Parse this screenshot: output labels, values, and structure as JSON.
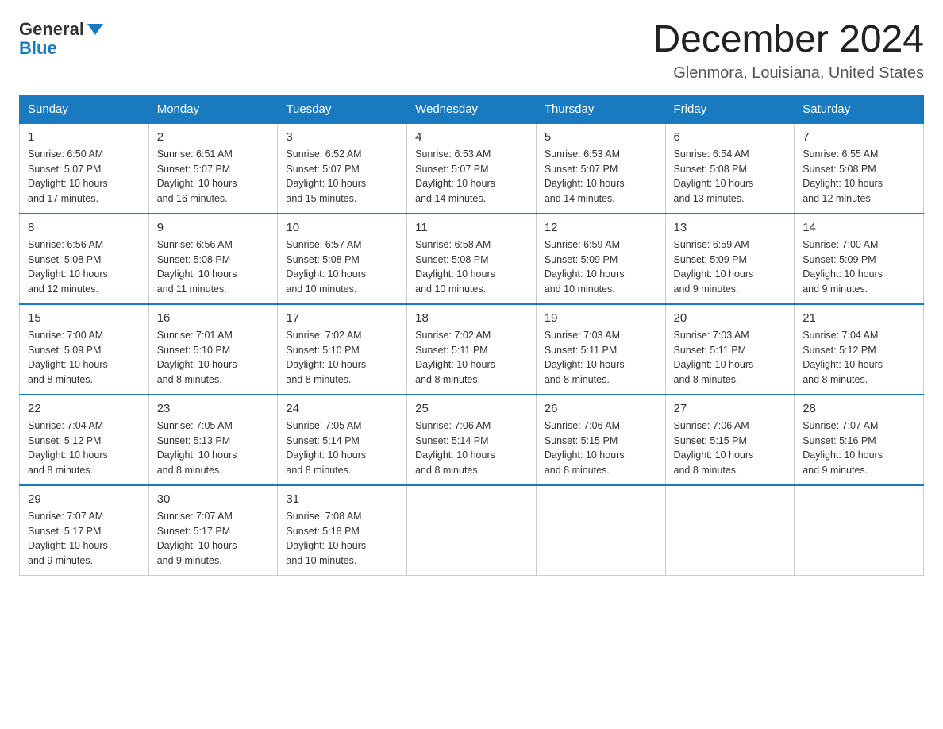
{
  "logo": {
    "general": "General",
    "blue": "Blue"
  },
  "title": "December 2024",
  "location": "Glenmora, Louisiana, United States",
  "weekdays": [
    "Sunday",
    "Monday",
    "Tuesday",
    "Wednesday",
    "Thursday",
    "Friday",
    "Saturday"
  ],
  "weeks": [
    [
      {
        "day": "1",
        "sunrise": "6:50 AM",
        "sunset": "5:07 PM",
        "daylight": "10 hours and 17 minutes."
      },
      {
        "day": "2",
        "sunrise": "6:51 AM",
        "sunset": "5:07 PM",
        "daylight": "10 hours and 16 minutes."
      },
      {
        "day": "3",
        "sunrise": "6:52 AM",
        "sunset": "5:07 PM",
        "daylight": "10 hours and 15 minutes."
      },
      {
        "day": "4",
        "sunrise": "6:53 AM",
        "sunset": "5:07 PM",
        "daylight": "10 hours and 14 minutes."
      },
      {
        "day": "5",
        "sunrise": "6:53 AM",
        "sunset": "5:07 PM",
        "daylight": "10 hours and 14 minutes."
      },
      {
        "day": "6",
        "sunrise": "6:54 AM",
        "sunset": "5:08 PM",
        "daylight": "10 hours and 13 minutes."
      },
      {
        "day": "7",
        "sunrise": "6:55 AM",
        "sunset": "5:08 PM",
        "daylight": "10 hours and 12 minutes."
      }
    ],
    [
      {
        "day": "8",
        "sunrise": "6:56 AM",
        "sunset": "5:08 PM",
        "daylight": "10 hours and 12 minutes."
      },
      {
        "day": "9",
        "sunrise": "6:56 AM",
        "sunset": "5:08 PM",
        "daylight": "10 hours and 11 minutes."
      },
      {
        "day": "10",
        "sunrise": "6:57 AM",
        "sunset": "5:08 PM",
        "daylight": "10 hours and 10 minutes."
      },
      {
        "day": "11",
        "sunrise": "6:58 AM",
        "sunset": "5:08 PM",
        "daylight": "10 hours and 10 minutes."
      },
      {
        "day": "12",
        "sunrise": "6:59 AM",
        "sunset": "5:09 PM",
        "daylight": "10 hours and 10 minutes."
      },
      {
        "day": "13",
        "sunrise": "6:59 AM",
        "sunset": "5:09 PM",
        "daylight": "10 hours and 9 minutes."
      },
      {
        "day": "14",
        "sunrise": "7:00 AM",
        "sunset": "5:09 PM",
        "daylight": "10 hours and 9 minutes."
      }
    ],
    [
      {
        "day": "15",
        "sunrise": "7:00 AM",
        "sunset": "5:09 PM",
        "daylight": "10 hours and 8 minutes."
      },
      {
        "day": "16",
        "sunrise": "7:01 AM",
        "sunset": "5:10 PM",
        "daylight": "10 hours and 8 minutes."
      },
      {
        "day": "17",
        "sunrise": "7:02 AM",
        "sunset": "5:10 PM",
        "daylight": "10 hours and 8 minutes."
      },
      {
        "day": "18",
        "sunrise": "7:02 AM",
        "sunset": "5:11 PM",
        "daylight": "10 hours and 8 minutes."
      },
      {
        "day": "19",
        "sunrise": "7:03 AM",
        "sunset": "5:11 PM",
        "daylight": "10 hours and 8 minutes."
      },
      {
        "day": "20",
        "sunrise": "7:03 AM",
        "sunset": "5:11 PM",
        "daylight": "10 hours and 8 minutes."
      },
      {
        "day": "21",
        "sunrise": "7:04 AM",
        "sunset": "5:12 PM",
        "daylight": "10 hours and 8 minutes."
      }
    ],
    [
      {
        "day": "22",
        "sunrise": "7:04 AM",
        "sunset": "5:12 PM",
        "daylight": "10 hours and 8 minutes."
      },
      {
        "day": "23",
        "sunrise": "7:05 AM",
        "sunset": "5:13 PM",
        "daylight": "10 hours and 8 minutes."
      },
      {
        "day": "24",
        "sunrise": "7:05 AM",
        "sunset": "5:14 PM",
        "daylight": "10 hours and 8 minutes."
      },
      {
        "day": "25",
        "sunrise": "7:06 AM",
        "sunset": "5:14 PM",
        "daylight": "10 hours and 8 minutes."
      },
      {
        "day": "26",
        "sunrise": "7:06 AM",
        "sunset": "5:15 PM",
        "daylight": "10 hours and 8 minutes."
      },
      {
        "day": "27",
        "sunrise": "7:06 AM",
        "sunset": "5:15 PM",
        "daylight": "10 hours and 8 minutes."
      },
      {
        "day": "28",
        "sunrise": "7:07 AM",
        "sunset": "5:16 PM",
        "daylight": "10 hours and 9 minutes."
      }
    ],
    [
      {
        "day": "29",
        "sunrise": "7:07 AM",
        "sunset": "5:17 PM",
        "daylight": "10 hours and 9 minutes."
      },
      {
        "day": "30",
        "sunrise": "7:07 AM",
        "sunset": "5:17 PM",
        "daylight": "10 hours and 9 minutes."
      },
      {
        "day": "31",
        "sunrise": "7:08 AM",
        "sunset": "5:18 PM",
        "daylight": "10 hours and 10 minutes."
      },
      null,
      null,
      null,
      null
    ]
  ],
  "labels": {
    "sunrise": "Sunrise:",
    "sunset": "Sunset:",
    "daylight": "Daylight:"
  }
}
